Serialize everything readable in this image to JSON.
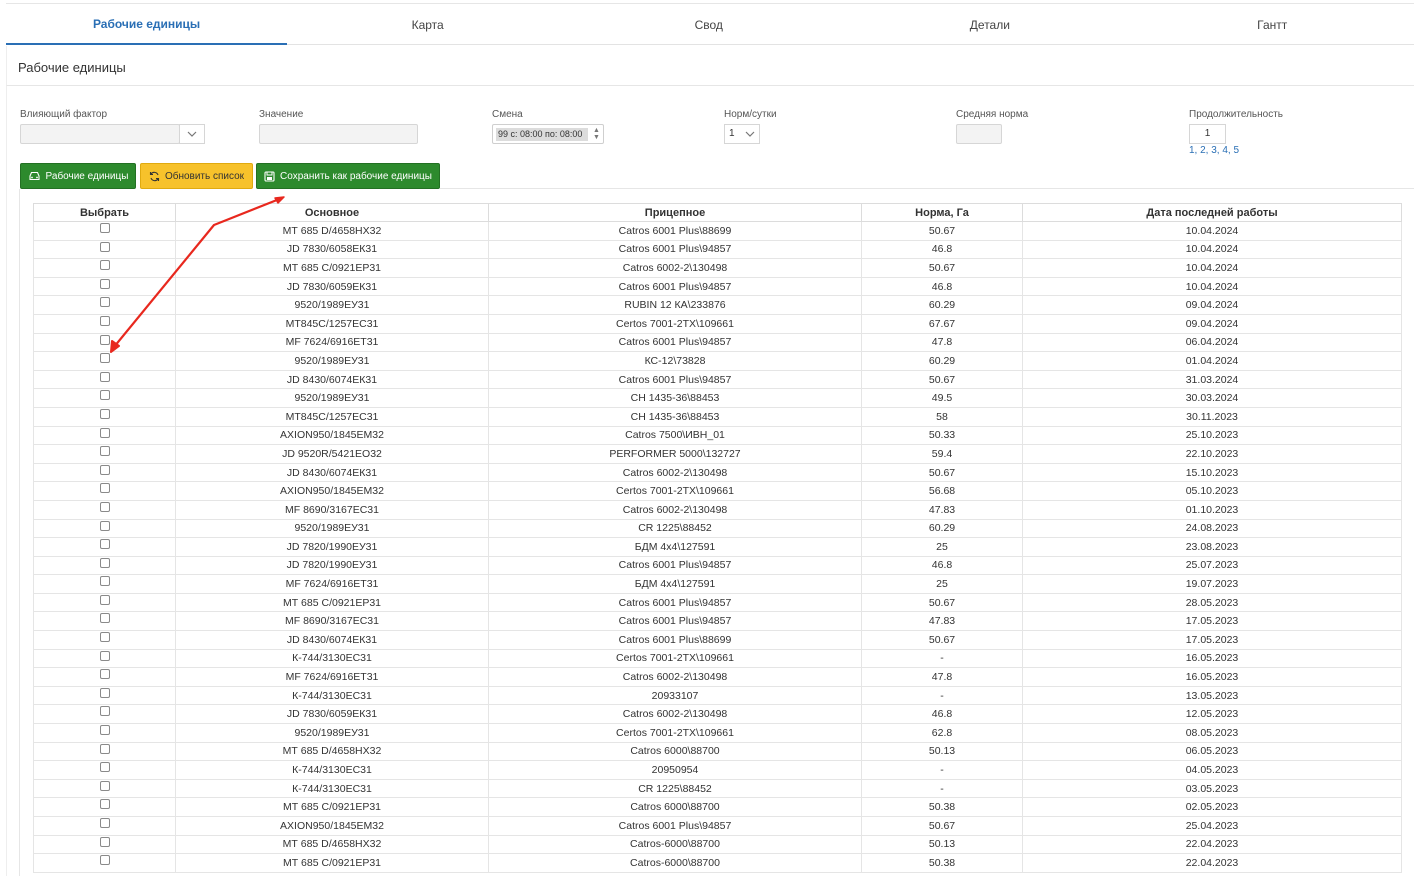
{
  "tabs": [
    {
      "label": "Рабочие единицы",
      "active": true
    },
    {
      "label": "Карта",
      "active": false
    },
    {
      "label": "Свод",
      "active": false
    },
    {
      "label": "Детали",
      "active": false
    },
    {
      "label": "Гантт",
      "active": false
    }
  ],
  "section_title": "Рабочие единицы",
  "filters": {
    "factor_label": "Влияющий фактор",
    "factor_value": "",
    "value_label": "Значение",
    "value_value": "",
    "shift_label": "Смена",
    "shift_value": "99 с: 08:00 по: 08:00",
    "norm_day_label": "Норм/сутки",
    "norm_day_value": "1",
    "avg_norm_label": "Средняя норма",
    "avg_norm_value": "",
    "duration_label": "Продолжительность",
    "duration_value": "1",
    "duration_links": "1, 2, 3, 4, 5"
  },
  "buttons": {
    "work_units": "Рабочие единицы",
    "refresh": "Обновить список",
    "save_as": "Сохранить как рабочие единицы"
  },
  "colors": {
    "accent": "#2a6fb5",
    "green": "#2d8a2d",
    "yellow": "#f7c22b",
    "annotation": "#e8281e"
  },
  "table": {
    "headers": [
      "Выбрать",
      "Основное",
      "Прицепное",
      "Норма, Га",
      "Дата последней работы"
    ],
    "rows": [
      [
        "МТ 685 D/4658НХ32",
        "Catros 6001 Plus\\88699",
        "50.67",
        "10.04.2024"
      ],
      [
        "JD 7830/6058ЕК31",
        "Catros 6001 Plus\\94857",
        "46.8",
        "10.04.2024"
      ],
      [
        "МТ 685 C/0921ЕР31",
        "Catros 6002-2\\130498",
        "50.67",
        "10.04.2024"
      ],
      [
        "JD 7830/6059ЕК31",
        "Catros 6001 Plus\\94857",
        "46.8",
        "10.04.2024"
      ],
      [
        "9520/1989ЕУ31",
        "RUBIN 12 КА\\233876",
        "60.29",
        "09.04.2024"
      ],
      [
        "МТ845С/1257ЕС31",
        "Certos 7001-2ТХ\\109661",
        "67.67",
        "09.04.2024"
      ],
      [
        "MF 7624/6916ЕТ31",
        "Catros 6001 Plus\\94857",
        "47.8",
        "06.04.2024"
      ],
      [
        "9520/1989ЕУ31",
        "КС-12\\73828",
        "60.29",
        "01.04.2024"
      ],
      [
        "JD 8430/6074ЕК31",
        "Catros 6001 Plus\\94857",
        "50.67",
        "31.03.2024"
      ],
      [
        "9520/1989ЕУ31",
        "СН 1435-36\\88453",
        "49.5",
        "30.03.2024"
      ],
      [
        "МТ845С/1257ЕС31",
        "СН 1435-36\\88453",
        "58",
        "30.11.2023"
      ],
      [
        "AXION950/1845ЕМ32",
        "Catros 7500\\ИВН_01",
        "50.33",
        "25.10.2023"
      ],
      [
        "JD 9520R/5421ЕО32",
        "PERFORMER 5000\\132727",
        "59.4",
        "22.10.2023"
      ],
      [
        "JD 8430/6074ЕК31",
        "Catros 6002-2\\130498",
        "50.67",
        "15.10.2023"
      ],
      [
        "AXION950/1845ЕМ32",
        "Certos 7001-2ТХ\\109661",
        "56.68",
        "05.10.2023"
      ],
      [
        "MF 8690/3167ЕС31",
        "Catros 6002-2\\130498",
        "47.83",
        "01.10.2023"
      ],
      [
        "9520/1989ЕУ31",
        "CR 1225\\88452",
        "60.29",
        "24.08.2023"
      ],
      [
        "JD 7820/1990ЕУ31",
        "БДМ 4х4\\127591",
        "25",
        "23.08.2023"
      ],
      [
        "JD 7820/1990ЕУ31",
        "Catros 6001 Plus\\94857",
        "46.8",
        "25.07.2023"
      ],
      [
        "MF 7624/6916ЕТ31",
        "БДМ 4х4\\127591",
        "25",
        "19.07.2023"
      ],
      [
        "МТ 685 C/0921ЕР31",
        "Catros 6001 Plus\\94857",
        "50.67",
        "28.05.2023"
      ],
      [
        "MF 8690/3167ЕС31",
        "Catros 6001 Plus\\94857",
        "47.83",
        "17.05.2023"
      ],
      [
        "JD 8430/6074ЕК31",
        "Catros 6001 Plus\\88699",
        "50.67",
        "17.05.2023"
      ],
      [
        "К-744/3130ЕС31",
        "Certos 7001-2ТХ\\109661",
        "-",
        "16.05.2023"
      ],
      [
        "MF 7624/6916ЕТ31",
        "Catros 6002-2\\130498",
        "47.8",
        "16.05.2023"
      ],
      [
        "К-744/3130ЕС31",
        "20933107",
        "-",
        "13.05.2023"
      ],
      [
        "JD 7830/6059ЕК31",
        "Catros 6002-2\\130498",
        "46.8",
        "12.05.2023"
      ],
      [
        "9520/1989ЕУ31",
        "Certos 7001-2ТХ\\109661",
        "62.8",
        "08.05.2023"
      ],
      [
        "МТ 685 D/4658НХ32",
        "Catros 6000\\88700",
        "50.13",
        "06.05.2023"
      ],
      [
        "К-744/3130ЕС31",
        "20950954",
        "-",
        "04.05.2023"
      ],
      [
        "К-744/3130ЕС31",
        "CR 1225\\88452",
        "-",
        "03.05.2023"
      ],
      [
        "МТ 685 C/0921ЕР31",
        "Catros 6000\\88700",
        "50.38",
        "02.05.2023"
      ],
      [
        "AXION950/1845ЕМ32",
        "Catros 6001 Plus\\94857",
        "50.67",
        "25.04.2023"
      ],
      [
        "МТ 685 D/4658НХ32",
        "Catros-6000\\88700",
        "50.13",
        "22.04.2023"
      ],
      [
        "МТ 685 C/0921ЕР31",
        "Catros-6000\\88700",
        "50.38",
        "22.04.2023"
      ]
    ]
  }
}
